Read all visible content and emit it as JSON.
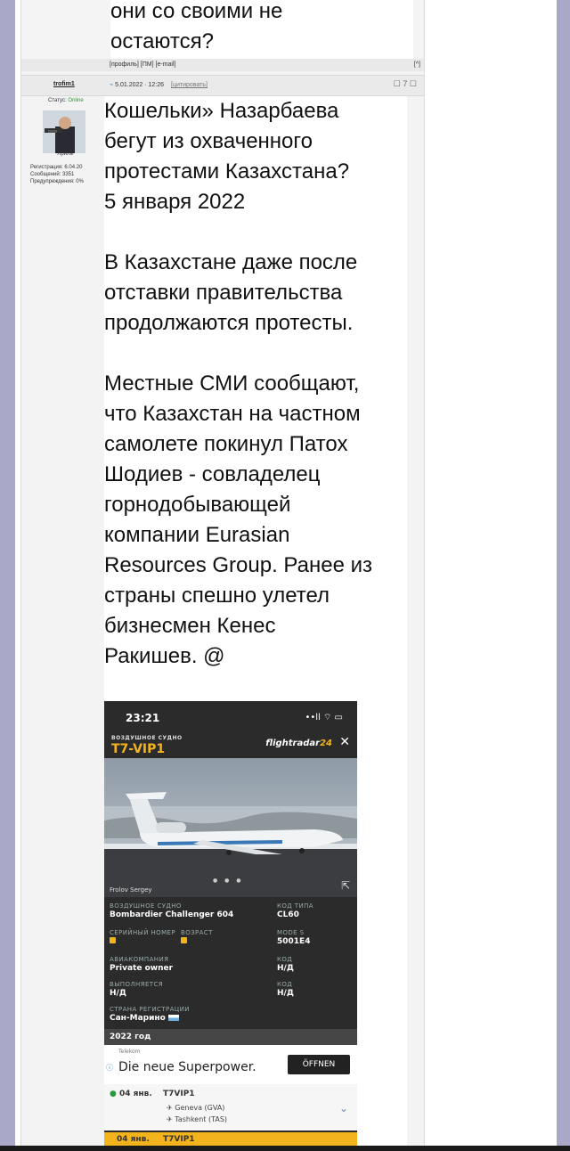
{
  "previous_post": {
    "text": "они со своими не\nостаются?",
    "links": "[профиль] [ПМ] [e-mail]",
    "top_icon": "[^]"
  },
  "post": {
    "author": "trofim1",
    "date": "5.01.2022 · 12:26",
    "quote_button": "[цитировать]",
    "header_right": "7",
    "status_label": "Статус:",
    "status_value": "Online",
    "rank": "Ярила",
    "stats": {
      "registration": "Регистрация: 6.04.20",
      "messages": "Сообщений: 3351",
      "warnings": "Предупреждения: 0%"
    },
    "body": "Кошельки» Назарбаева\nбегут из охваченного\nпротестами Казахстана?\n5 января 2022\n\nВ Казахстане даже после\nотставки правительства\nпродолжаются протесты.\n\nМестные СМИ сообщают,\nчто Казахстан на частном\nсамолете покинул Патох\nШодиев - совладелец\nгорнодобывающей\nкомпании Eurasian\nResources Group. Ранее из\nстраны спешно улетел\nбизнесмен Кенес\nРакишев. @"
  },
  "screenshot": {
    "time": "23:21",
    "signal": "••ll ⌔ ▭",
    "aircraft_label": "ВОЗДУШНОЕ СУДНО",
    "registration": "T7-VIP1",
    "logo": "flightradar",
    "logo_num": "24",
    "close": "✕",
    "photographer": "Frolov Sergey",
    "dots": "● ● ●",
    "ext": "⇱",
    "fields": {
      "aircraft_k": "ВОЗДУШНОЕ СУДНО",
      "aircraft_v": "Bombardier Challenger 604",
      "type_k": "КОД ТИПА",
      "type_v": "CL60",
      "serial_k": "СЕРИЙНЫЙ НОМЕР",
      "age_k": "ВОЗРАСТ",
      "modes_k": "MODE S",
      "modes_v": "5001E4",
      "airline_k": "АВИАКОМПАНИЯ",
      "airline_v": "Private owner",
      "code_k": "КОД",
      "code_v": "Н/Д",
      "operator_k": "ВЫПОЛНЯЕТСЯ",
      "operator_v": "Н/Д",
      "code2_k": "КОД",
      "code2_v": "Н/Д",
      "country_k": "СТРАНА РЕГИСТРАЦИИ",
      "country_v": "Сан-Марино"
    },
    "year": "2022 год",
    "ad": {
      "brand": "Telekom",
      "text": "Die neue Superpower.",
      "button": "ÖFFNEN"
    },
    "flight": {
      "date": "04 янв.",
      "code": "T7VIP1",
      "from": "Geneva (GVA)",
      "to": "Tashkent (TAS)",
      "next_date": "04 янв.",
      "next_code": "T7VIP1"
    }
  }
}
